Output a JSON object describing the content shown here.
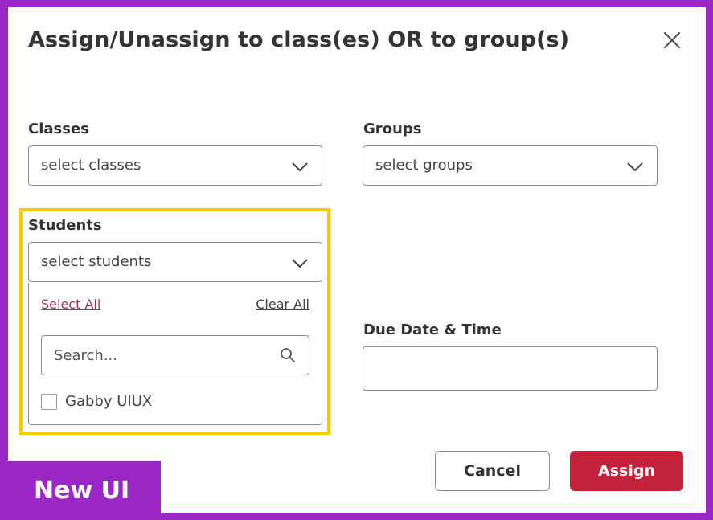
{
  "dialog": {
    "title": "Assign/Unassign to class(es) OR to group(s)",
    "close_icon": "close-icon"
  },
  "classes": {
    "label": "Classes",
    "placeholder": "select classes"
  },
  "groups": {
    "label": "Groups",
    "placeholder": "select groups"
  },
  "students": {
    "label": "Students",
    "placeholder": "select students",
    "select_all": "Select All",
    "clear_all": "Clear All",
    "search_placeholder": "Search...",
    "options": [
      {
        "label": "Gabby UIUX",
        "checked": false
      }
    ]
  },
  "due": {
    "label": "Due Date & Time",
    "value": ""
  },
  "actions": {
    "cancel": "Cancel",
    "assign": "Assign"
  },
  "badge": {
    "text": "New UI"
  },
  "colors": {
    "accent": "#c4213a",
    "frame": "#9b27c7",
    "highlight": "#f7ca00",
    "link_select_all": "#a8344a"
  }
}
